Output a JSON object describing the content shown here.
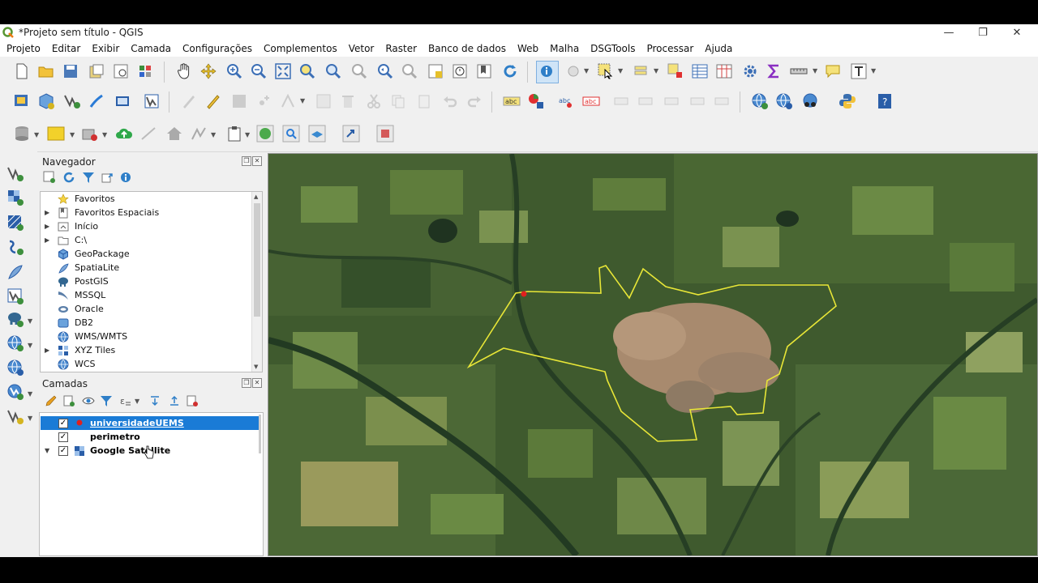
{
  "window": {
    "title": "*Projeto sem título - QGIS",
    "minimize": "—",
    "restore": "❐",
    "close": "✕"
  },
  "menu": [
    "Projeto",
    "Editar",
    "Exibir",
    "Camada",
    "Configurações",
    "Complementos",
    "Vetor",
    "Raster",
    "Banco de dados",
    "Web",
    "Malha",
    "DSGTools",
    "Processar",
    "Ajuda"
  ],
  "navigator": {
    "title": "Navegador",
    "items": [
      {
        "label": "Favoritos",
        "icon": "star-icon",
        "expandable": false
      },
      {
        "label": "Favoritos Espaciais",
        "icon": "spatial-bookmarks-icon",
        "expandable": true
      },
      {
        "label": "Início",
        "icon": "home-folder-icon",
        "expandable": true
      },
      {
        "label": "C:\\",
        "icon": "folder-icon",
        "expandable": true
      },
      {
        "label": "GeoPackage",
        "icon": "geopackage-icon",
        "expandable": false
      },
      {
        "label": "SpatiaLite",
        "icon": "spatialite-icon",
        "expandable": false
      },
      {
        "label": "PostGIS",
        "icon": "postgis-icon",
        "expandable": false
      },
      {
        "label": "MSSQL",
        "icon": "mssql-icon",
        "expandable": false
      },
      {
        "label": "Oracle",
        "icon": "oracle-icon",
        "expandable": false
      },
      {
        "label": "DB2",
        "icon": "db2-icon",
        "expandable": false
      },
      {
        "label": "WMS/WMTS",
        "icon": "wms-icon",
        "expandable": false
      },
      {
        "label": "XYZ Tiles",
        "icon": "xyz-tiles-icon",
        "expandable": true
      },
      {
        "label": "WCS",
        "icon": "wcs-icon",
        "expandable": false
      }
    ]
  },
  "layers": {
    "title": "Camadas",
    "items": [
      {
        "label": "universidadeUEMS",
        "checked": true,
        "selected": true
      },
      {
        "label": "perimetro",
        "checked": true,
        "selected": false
      },
      {
        "label": "Google Satellite",
        "checked": true,
        "selected": false
      }
    ]
  },
  "colors": {
    "selection": "#1a7bd6",
    "perimeter": "#e8e637",
    "point": "#e0201e",
    "qgis_green": "#589632"
  }
}
